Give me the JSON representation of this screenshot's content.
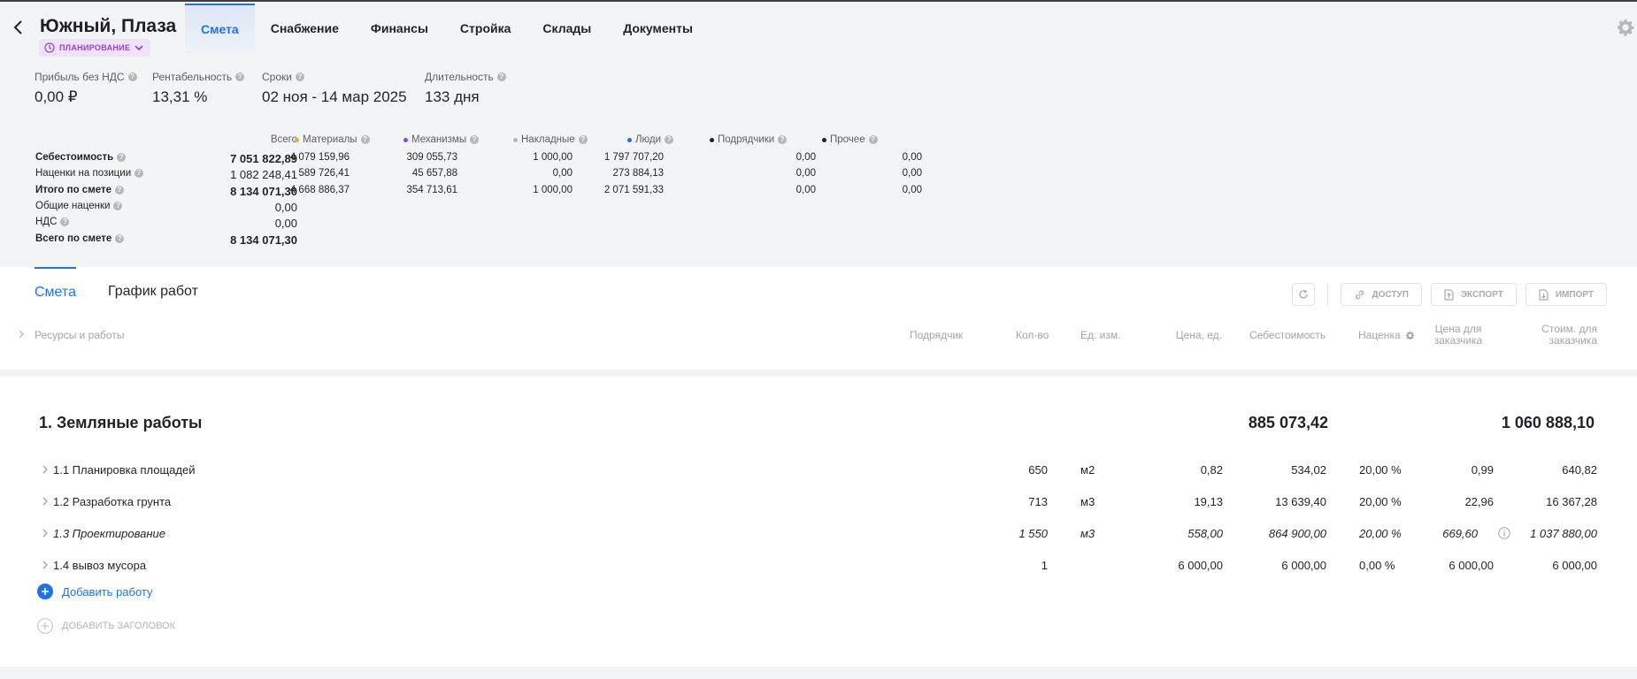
{
  "project": {
    "title": "Южный, Плаза",
    "status": "ПЛАНИРОВАНИЕ"
  },
  "nav": [
    "Смета",
    "Снабжение",
    "Финансы",
    "Стройка",
    "Склады",
    "Документы"
  ],
  "kpis": [
    {
      "label": "Прибыль без НДС",
      "value": "0,00 ₽"
    },
    {
      "label": "Рентабельность",
      "value": "13,31 %"
    },
    {
      "label": "Сроки",
      "value": "02 ноя - 14 мар 2025"
    },
    {
      "label": "Длительность",
      "value": "133 дня"
    }
  ],
  "summary": {
    "headers": [
      "Всего",
      "Материалы",
      "Механизмы",
      "Накладные",
      "Люди",
      "Подрядчики",
      "Прочее"
    ],
    "dot_colors": [
      "#f5a623",
      "#9b3fd6",
      "#b3b8bf",
      "#1f73e8",
      "#1f2328",
      "#1f2328"
    ],
    "rows": [
      {
        "label": "Себестоимость",
        "total": "7 051 822,89",
        "cells": [
          "4 079 159,96",
          "309 055,73",
          "1 000,00",
          "1 797 707,20",
          "0,00",
          "0,00"
        ]
      },
      {
        "label": "Наценки на позиции",
        "total": "1 082 248,41",
        "cells": [
          "589 726,41",
          "45 657,88",
          "0,00",
          "273 884,13",
          "0,00",
          "0,00"
        ]
      },
      {
        "label": "Итого по смете",
        "total": "8 134 071,30",
        "cells": [
          "4 668 886,37",
          "354 713,61",
          "1 000,00",
          "2 071 591,33",
          "0,00",
          "0,00"
        ]
      },
      {
        "label": "Общие наценки",
        "total": "0,00",
        "cells": []
      },
      {
        "label": "НДС",
        "total": "0,00",
        "cells": []
      },
      {
        "label": "Всего по смете",
        "total": "8 134 071,30",
        "cells": []
      }
    ]
  },
  "subtabs": [
    "Смета",
    "График работ"
  ],
  "toolbar": {
    "access": "ДОСТУП",
    "export": "ЭКСПОРТ",
    "import": "ИМПОРТ"
  },
  "columns": {
    "resources": "Ресурсы и работы",
    "contractor": "Подрядчик",
    "qty": "Кол-во",
    "unit": "Ед. изм.",
    "price": "Цена, ед.",
    "cost": "Себестоимость",
    "markup": "Наценка",
    "client_price": "Цена для заказчика",
    "client_cost": "Стоим. для заказчика"
  },
  "section": {
    "title": "1. Земляные работы",
    "cost_total": "885 073,42",
    "client_total": "1 060 888,10"
  },
  "items": [
    {
      "name": "1.1 Планировка площадей",
      "qty": "650",
      "unit": "м2",
      "price": "0,82",
      "cost": "534,02",
      "markup": "20,00 %",
      "client_price": "0,99",
      "client_cost": "640,82"
    },
    {
      "name": "1.2 Разработка грунта",
      "qty": "713",
      "unit": "м3",
      "price": "19,13",
      "cost": "13 639,40",
      "markup": "20,00 %",
      "client_price": "22,96",
      "client_cost": "16 367,28"
    },
    {
      "name": "1.3 Проектирование",
      "qty": "1 550",
      "unit": "м3",
      "price": "558,00",
      "cost": "864 900,00",
      "markup": "20,00 %",
      "client_price": "669,60",
      "client_cost": "1 037 880,00"
    },
    {
      "name": "1.4 вывоз мусора",
      "qty": "1",
      "unit": "",
      "price": "6 000,00",
      "cost": "6 000,00",
      "markup": "0,00 %",
      "client_price": "6 000,00",
      "client_cost": "6 000,00"
    }
  ],
  "actions": {
    "add_work": "Добавить работу",
    "add_header": "ДОБАВИТЬ ЗАГОЛОВОК"
  },
  "colors": {
    "accent": "#1f73e8",
    "status_purple": "#9b3fd6"
  },
  "icons": [
    "back-arrow-icon",
    "clock-icon",
    "chevron-down-icon",
    "gear-icon",
    "help-icon",
    "refresh-icon",
    "link-icon",
    "export-file-icon",
    "import-file-icon",
    "chevron-right-icon",
    "info-icon",
    "plus-circle-icon"
  ]
}
